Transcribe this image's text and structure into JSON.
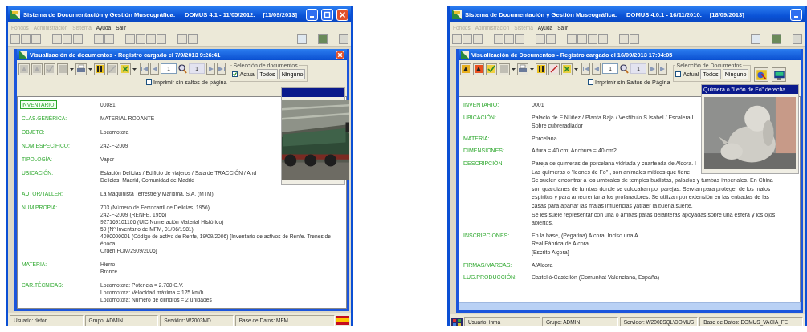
{
  "windows": [
    {
      "title_bar": {
        "title": "Sistema de Documentación y Gestión Museográfica.",
        "version": "DOMUS 4.1 - 11/05/2012.",
        "date": "[11/09/2013]",
        "buttons": [
          {
            "kind": "minimize"
          },
          {
            "kind": "maximize"
          },
          {
            "kind": "close"
          }
        ]
      },
      "menu": [
        {
          "label": "Fondos",
          "disabled": true
        },
        {
          "label": "Administración",
          "disabled": true
        },
        {
          "label": "Sistema",
          "disabled": true
        },
        {
          "label": "Ayuda",
          "disabled": false
        },
        {
          "label": "Salir",
          "disabled": false
        }
      ],
      "document": {
        "title": "Visualización de documentos - Registro cargado el 7/9/2013 9:26:41",
        "tools_enabled": false,
        "page": "1",
        "count": "1",
        "print_option": {
          "label": "Imprimir sin saltos de página",
          "checked": false
        },
        "selection": {
          "legend": "Selección de documentos",
          "actual": {
            "label": "Actual",
            "checked": true
          },
          "buttons": [
            "Todos",
            "Ninguno"
          ]
        },
        "extra_tools": false,
        "photo": {
          "kind": "locomotive"
        },
        "horizontal_scrollbar": false,
        "fields": [
          {
            "label": "INVENTARIO:",
            "focused": true,
            "lines": [
              "00081"
            ]
          },
          {
            "label": "CLAS.GENÉRICA:",
            "focused": false,
            "lines": [
              "MATERIAL RODANTE"
            ]
          },
          {
            "label": "OBJETO:",
            "focused": false,
            "lines": [
              "Locomotora"
            ]
          },
          {
            "label": "NOM.ESPECÍFICO:",
            "focused": false,
            "lines": [
              "242-F-2009"
            ]
          },
          {
            "label": "TIPOLOGÍA:",
            "focused": false,
            "lines": [
              "Vapor"
            ]
          },
          {
            "label": "UBICACIÓN:",
            "focused": false,
            "lines": [
              "Estación Delicias / Edificio de viajeros / Sala de TRACCIÓN / And",
              "Delicias, Madrid, Comunidad de Madrid"
            ]
          },
          {
            "label": "AUTOR/TALLER:",
            "focused": false,
            "lines": [
              "La Maquinista Terrestre y Marítima, S.A. (MTM)"
            ]
          },
          {
            "label": "NUM.PROPIA:",
            "focused": false,
            "lines": [
              "703 (Número de Ferrocarril de Delicias, 1956)",
              "242-F-2009 (RENFE, 1956)",
              "927169101106 (UIC Numeración Material Histórico)",
              "59 (Nº Inventario de MFM, 01/06/1981)",
              "4090000001 (Código de activo de Renfe, 19/09/2006) [Inventario de activos de Renfe. Trenes de",
              "época",
              "Orden FOM/2909/2006]"
            ]
          },
          {
            "label": "MATERIA:",
            "focused": false,
            "lines": [
              "Hierro",
              "Bronce"
            ]
          },
          {
            "label": "CAR.TÉCNICAS:",
            "focused": false,
            "lines": [
              "Locomotora: Potencia = 2.700 C.V.",
              "Locomotora: Velocidad máxima = 125 km/h",
              "Locomotora: Número de cilindros = 2 unidades"
            ]
          }
        ]
      },
      "status_icon": {
        "kind": "flag"
      },
      "status": [
        "Usuario: rleton",
        "Grupo: ADMIN",
        "Servidor: W2003MD",
        "Base de Datos: MFM"
      ]
    },
    {
      "title_bar": {
        "title": "Sistema de Documentación y Gestión Museográfica.",
        "version": "DOMUS 4.0.1 - 16/11/2010.",
        "date": "[18/09/2013]",
        "buttons": [
          {
            "kind": "minimize"
          }
        ]
      },
      "menu": [
        {
          "label": "Fondos",
          "disabled": true
        },
        {
          "label": "Administración",
          "disabled": true
        },
        {
          "label": "Sistema",
          "disabled": true
        },
        {
          "label": "Ayuda",
          "disabled": false
        },
        {
          "label": "Salir",
          "disabled": false
        }
      ],
      "document": {
        "title": "Visualización de Documentos - Registro cargado el 16/09/2013 17:04:05",
        "tools_enabled": true,
        "page": "1",
        "count": "1",
        "print_option": {
          "label": "Imprimir sin Saltos de Página",
          "checked": false
        },
        "selection": {
          "legend": "Selección de Documentos",
          "actual": {
            "label": "Actual",
            "checked": false
          },
          "buttons": [
            "Todos",
            "Ninguno"
          ]
        },
        "extra_tools": true,
        "photo": {
          "kind": "statue",
          "caption": "Quimera o \"León de Fo\" derecha"
        },
        "horizontal_scrollbar": true,
        "fields": [
          {
            "label": "INVENTARIO:",
            "focused": false,
            "lines": [
              "0001"
            ]
          },
          {
            "label": "UBICACIÓN:",
            "focused": false,
            "lines": [
              "Palacio de F Núñez / Planta Baja / Vestíbulo S Isabel / Escalera I",
              "Sobre cubreradiador"
            ]
          },
          {
            "label": "MATERIA:",
            "focused": false,
            "lines": [
              "Porcelana"
            ]
          },
          {
            "label": "DIMENSIONES:",
            "focused": false,
            "lines": [
              "Altura = 40 cm; Anchura = 40 cm2"
            ]
          },
          {
            "label": "DESCRIPCIÓN:",
            "focused": false,
            "lines": [
              "Pareja de quimeras de porcelana vidriada y cuarteada de Alcora. I",
              "Las quimeras o \"leones de Fo\" , son animales míticos que tiene",
              "Se suelen encontrar a los umbrales de templos budistas, palacios y tumbas imperiales. En China",
              "son guardianes de tumbas donde se colocaban por parejas. Servían para proteger de los malos",
              "espíritus y para amedrentar a los profanadores. Se utilizan por extensión en las entradas de las",
              "casas para apartar las malas influencias yatraer la buena suerte.",
              "Se les suele representar con una o ambas patas delanteras apoyadas sobre una esfera y los ojos",
              "abiertos."
            ]
          },
          {
            "label": "INSCRIPCIONES:",
            "focused": false,
            "lines": [
              "En la base, (Pegatina) Alcora. Inciso una A",
              "Real Fábrica de Alcora",
              "[Escrito Alçora]"
            ]
          },
          {
            "label": "FIRMAS/MARCAS:",
            "focused": false,
            "lines": [
              "A/Alcora"
            ]
          },
          {
            "label": "LUG.PRODUCCIÓN:",
            "focused": false,
            "lines": [
              "Castelló-Castellón (Comunitat Valenciana, España)"
            ]
          }
        ]
      },
      "status_icon": {
        "kind": "app"
      },
      "status": [
        "Usuario: inma",
        "Grupo: ADMIN",
        "Servidor: W2008SQL\\DOMUS",
        "Base de Datos: DOMUS_VACIA_FE"
      ]
    }
  ]
}
